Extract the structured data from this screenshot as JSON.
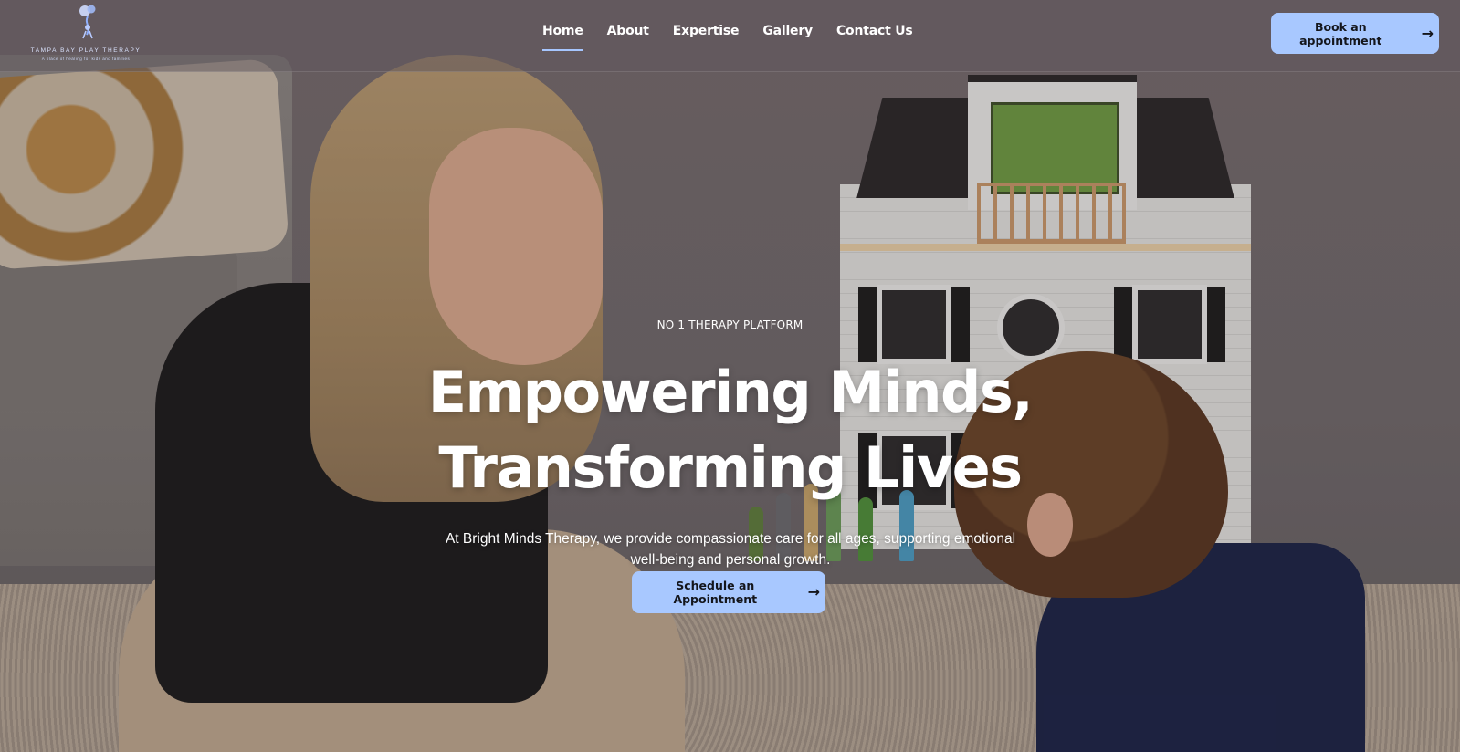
{
  "brand": {
    "name": "TAMPA BAY PLAY THERAPY",
    "tagline": "A place of healing for kids and families",
    "logo_icon": "balloon-figure-icon"
  },
  "nav": {
    "items": [
      {
        "label": "Home",
        "active": true
      },
      {
        "label": "About",
        "active": false
      },
      {
        "label": "Expertise",
        "active": false
      },
      {
        "label": "Gallery",
        "active": false
      },
      {
        "label": "Contact Us",
        "active": false
      }
    ]
  },
  "header": {
    "book_label": "Book an appointment",
    "book_icon": "arrow-right-icon"
  },
  "hero": {
    "eyebrow": "NO 1 THERAPY PLATFORM",
    "headline_line1": "Empowering Minds,",
    "headline_line2": "Transforming Lives",
    "subtext": "At Bright Minds Therapy, we provide compassionate care for all ages, supporting emotional well-being and personal growth.",
    "cta_label": "Schedule an Appointment",
    "cta_icon": "arrow-right-icon"
  },
  "colors": {
    "button_bg": "#a8c8ff",
    "button_text": "#14161c",
    "active_underline": "#a6c6ff"
  }
}
